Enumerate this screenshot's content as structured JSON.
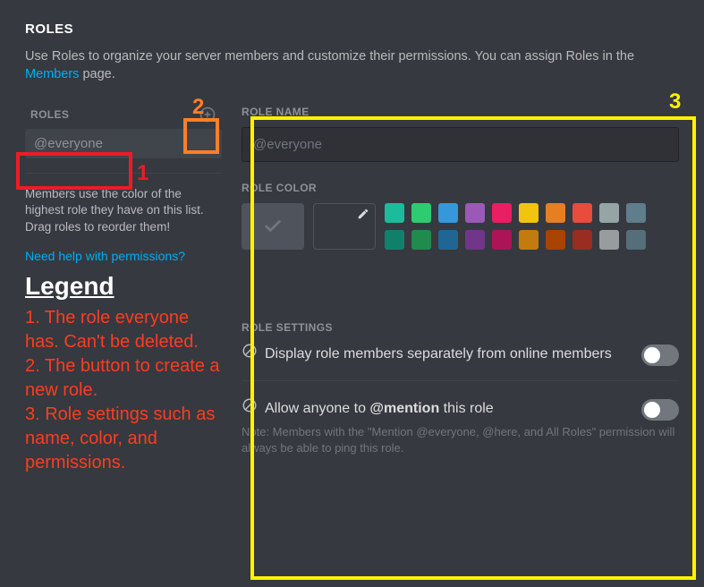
{
  "header": {
    "title": "ROLES",
    "description_pre": "Use Roles to organize your server members and customize their permissions. You can assign Roles in the ",
    "description_link": "Members",
    "description_post": " page."
  },
  "sidebar": {
    "label": "ROLES",
    "items": [
      {
        "name": "@everyone"
      }
    ],
    "note": "Members use the color of the highest role they have on this list. Drag roles to reorder them!",
    "help_link": "Need help with permissions?"
  },
  "legend": {
    "title": "Legend",
    "items": [
      "1. The role everyone has. Can't be deleted.",
      "2. The button to create a new role.",
      "3. Role settings such as name, color, and permissions."
    ]
  },
  "role_panel": {
    "name_label": "ROLE NAME",
    "name_value": "@everyone",
    "color_label": "ROLE COLOR",
    "swatch_rows": [
      [
        "#1abc9c",
        "#2ecc71",
        "#3498db",
        "#9b59b6",
        "#e91e63",
        "#f1c40f",
        "#e67e22",
        "#e74c3c",
        "#95a5a6",
        "#607d8b"
      ],
      [
        "#11806a",
        "#1f8b4c",
        "#206694",
        "#71368a",
        "#ad1457",
        "#c27c0e",
        "#a84300",
        "#992d22",
        "#979c9f",
        "#546e7a"
      ]
    ],
    "settings_label": "ROLE SETTINGS",
    "settings": [
      {
        "label_pre": "Display role members separately from online members",
        "label_bold": "",
        "label_post": "",
        "enabled": false,
        "note": ""
      },
      {
        "label_pre": "Allow anyone to ",
        "label_bold": "@mention",
        "label_post": " this role",
        "enabled": false,
        "note": "Note: Members with the \"Mention @everyone, @here, and All Roles\" permission will always be able to ping this role."
      }
    ]
  },
  "annotations": {
    "n1": "1",
    "n2": "2",
    "n3": "3"
  }
}
